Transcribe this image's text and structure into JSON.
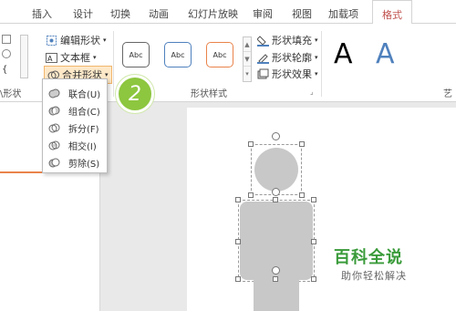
{
  "tabs": [
    "插入",
    "设计",
    "切换",
    "动画",
    "幻灯片放映",
    "审阅",
    "视图",
    "加载项",
    "格式"
  ],
  "active_tab": "格式",
  "insert_group": {
    "edit_shape": "编辑形状",
    "text_box": "文本框",
    "merge_shapes": "合并形状",
    "label_partial": "\\形状"
  },
  "shape_styles": {
    "samples": [
      "Abc",
      "Abc",
      "Abc"
    ],
    "fill": "形状填充",
    "outline": "形状轮廓",
    "effects": "形状效果",
    "label": "形状样式"
  },
  "wordart": {
    "letters": [
      "A",
      "A"
    ],
    "label_partial": "艺"
  },
  "merge_menu": [
    {
      "label": "联合(U)",
      "icon": "union-icon"
    },
    {
      "label": "组合(C)",
      "icon": "combine-icon"
    },
    {
      "label": "拆分(F)",
      "icon": "fragment-icon"
    },
    {
      "label": "相交(I)",
      "icon": "intersect-icon"
    },
    {
      "label": "剪除(S)",
      "icon": "subtract-icon"
    }
  ],
  "step_badge": "2",
  "watermark": {
    "title": "百科全说",
    "subtitle": "助你轻松解决"
  },
  "colors": {
    "accent": "#c0504d",
    "badge": "#8dc63f",
    "watermark": "#3a9b3a"
  }
}
